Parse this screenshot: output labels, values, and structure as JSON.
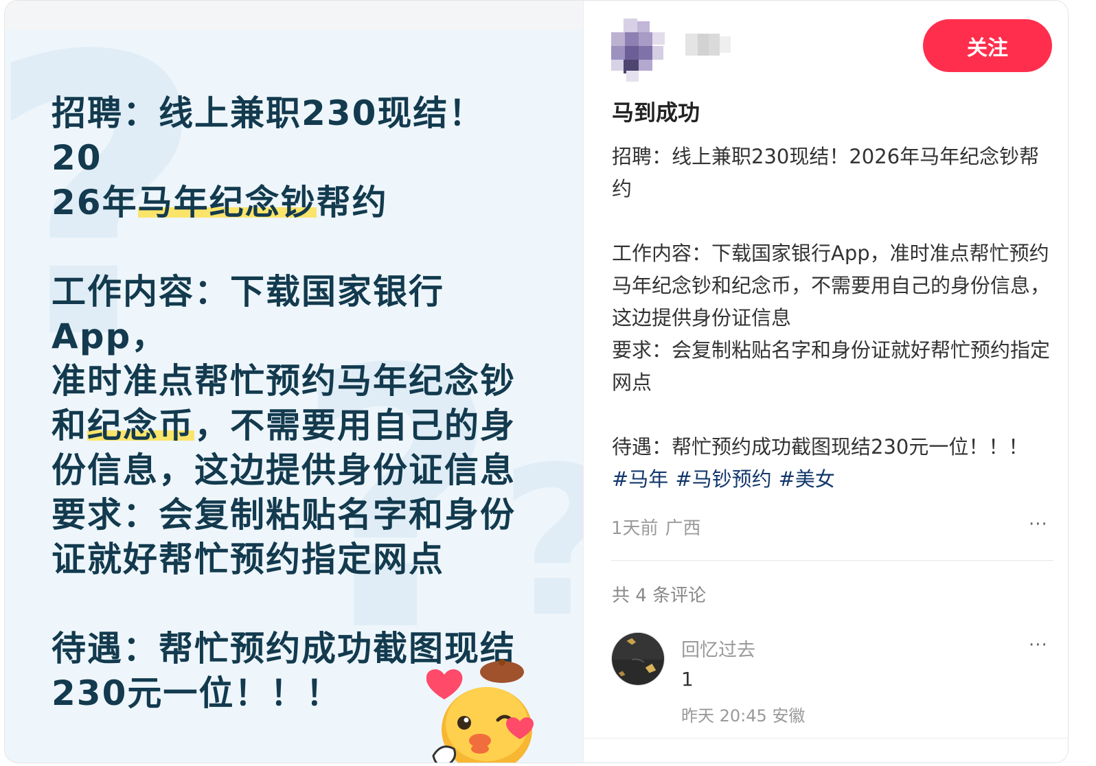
{
  "poster": {
    "line1": "招聘：线上兼职230现结！20",
    "line2a": "26年",
    "line2b": "马年纪念钞",
    "line2c": "帮约",
    "p2_line1": "工作内容：下载国家银行App，",
    "p2_line2": "准时准点帮忙预约马年纪念钞",
    "p2_line3a": "和",
    "p2_line3b": "纪念币",
    "p2_line3c": "，不需要用自己的身",
    "p2_line4": "份信息，这边提供身份证信息",
    "p2_line5": "要求：会复制粘贴名字和身份",
    "p2_line6": "证就好帮忙预约指定网点",
    "p3_line1": "待遇：帮忙预约成功截图现结",
    "p3_line2": "230元一位！！！"
  },
  "author": {
    "follow_label": "关注"
  },
  "post": {
    "title": "马到成功",
    "body_p1": "招聘：线上兼职230现结！2026年马年纪念钞帮约",
    "body_p2a": "工作内容：下载国家银行App，准时准点帮忙预约马年纪念钞和纪念币，不需要用自己的身份信息，这边提供身份证信息",
    "body_p2b": "要求：会复制粘贴名字和身份证就好帮忙预约指定网点",
    "body_p3": "待遇：帮忙预约成功截图现结230元一位！！！",
    "tags": [
      "#马年",
      "#马钞预约",
      "#美女"
    ],
    "time": "1天前",
    "location": "广西",
    "more": "···"
  },
  "comments": {
    "count_label": "共 4 条评论",
    "items": [
      {
        "name": "回忆过去",
        "text": "1",
        "meta": "昨天 20:45 安徽",
        "more": "···"
      }
    ]
  },
  "colors": {
    "accent": "#ff2e4d",
    "tag": "#13386c",
    "poster_text": "#133a4e",
    "poster_bg": "#eef6fb",
    "highlight": "#fbe46a"
  }
}
